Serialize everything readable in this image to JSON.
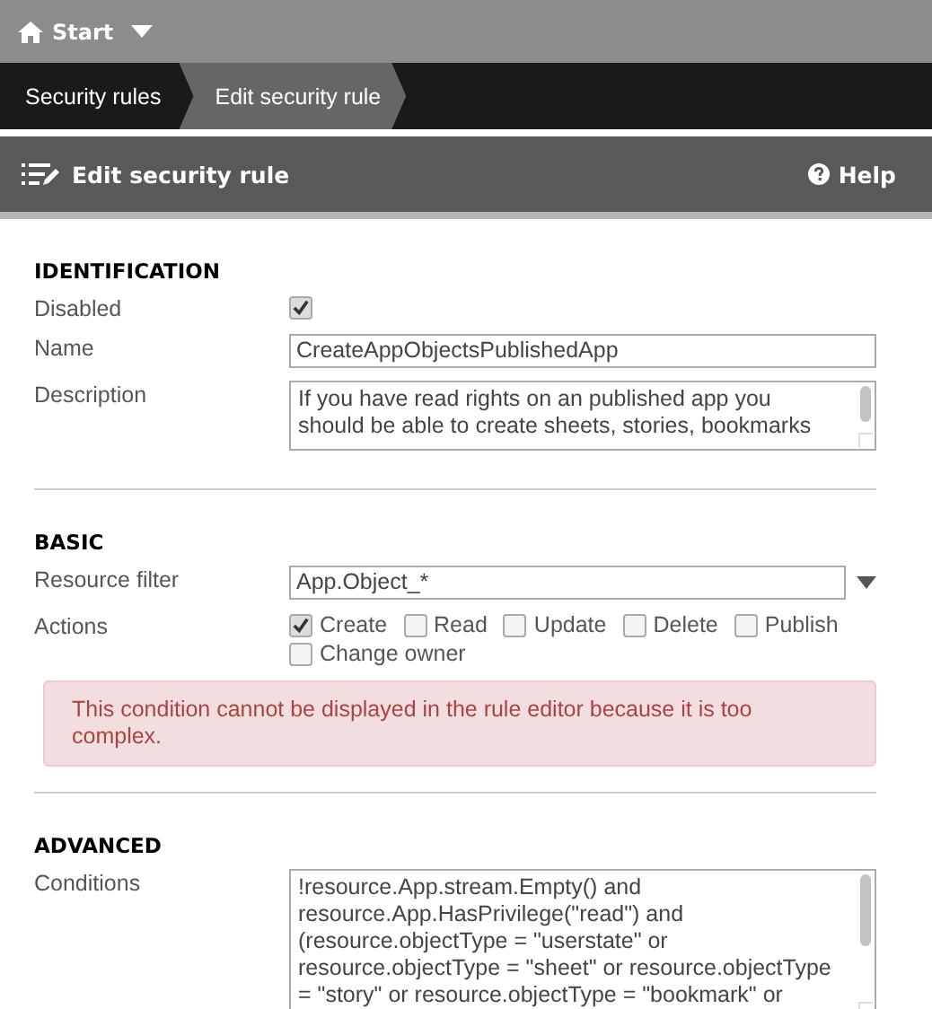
{
  "top_bar": {
    "home": "Start"
  },
  "breadcrumbs": [
    {
      "label": "Security rules",
      "selected": false
    },
    {
      "label": "Edit security rule",
      "selected": true
    }
  ],
  "header": {
    "title": "Edit security rule",
    "help": "Help"
  },
  "identification": {
    "heading": "IDENTIFICATION",
    "disabled": {
      "label": "Disabled",
      "checked": true
    },
    "name": {
      "label": "Name",
      "value": "CreateAppObjectsPublishedApp"
    },
    "description": {
      "label": "Description",
      "lines": [
        "If you have read rights on an published app you",
        "should be able to create sheets, stories, bookmarks"
      ]
    }
  },
  "basic": {
    "heading": "BASIC",
    "resource_filter": {
      "label": "Resource filter",
      "value": "App.Object_*"
    },
    "actions_label": "Actions",
    "actions": [
      {
        "label": "Create",
        "checked": true
      },
      {
        "label": "Read",
        "checked": false
      },
      {
        "label": "Update",
        "checked": false
      },
      {
        "label": "Delete",
        "checked": false
      },
      {
        "label": "Publish",
        "checked": false
      },
      {
        "label": "Change owner",
        "checked": false
      }
    ],
    "alert": "This condition cannot be displayed in the rule editor because it is too complex."
  },
  "advanced": {
    "heading": "ADVANCED",
    "conditions": {
      "label": "Conditions",
      "lines": [
        "!resource.App.stream.Empty() and",
        "resource.App.HasPrivilege(\"read\") and",
        "(resource.objectType = \"userstate\" or",
        "resource.objectType = \"sheet\" or resource.objectType",
        "= \"story\" or resource.objectType = \"bookmark\" or"
      ]
    }
  }
}
